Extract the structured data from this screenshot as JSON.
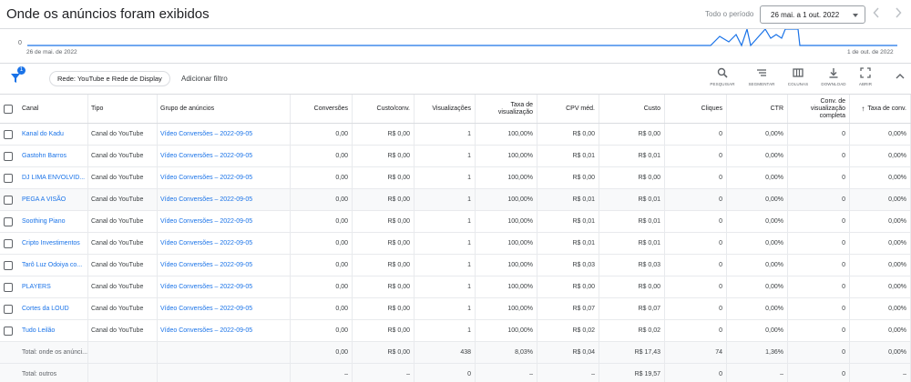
{
  "header": {
    "title": "Onde os anúncios foram exibidos",
    "period_label": "Todo o período",
    "date_range": "26 mai. a 1 out. 2022",
    "prev_icon": "chevron-left-icon",
    "next_icon": "chevron-right-icon"
  },
  "chart": {
    "y_zero": "0",
    "start_date": "26 de mai. de 2022",
    "end_date": "1 de out. de 2022",
    "line_color": "#1a73e8"
  },
  "filter_bar": {
    "badge": "1",
    "chip": "Rede: YouTube e Rede de Display",
    "add_filter": "Adicionar filtro",
    "tools": [
      {
        "icon": "search-icon",
        "label": "PESQUISAR"
      },
      {
        "icon": "segment-icon",
        "label": "SEGMENTAR"
      },
      {
        "icon": "columns-icon",
        "label": "COLUNAS"
      },
      {
        "icon": "download-icon",
        "label": "DOWNLOAD"
      },
      {
        "icon": "expand-icon",
        "label": "ABRIR"
      }
    ]
  },
  "table": {
    "columns": [
      "Canal",
      "Tipo",
      "Grupo de anúncios",
      "Conversões",
      "Custo/conv.",
      "Visualizações",
      "Taxa de visualização",
      "CPV méd.",
      "Custo",
      "Cliques",
      "CTR",
      "Conv. de visualização completa",
      "Taxa de conv."
    ],
    "rows": [
      [
        "Kanal do Kadu",
        "Canal do YouTube",
        "Vídeo Conversões – 2022-09-05",
        "0,00",
        "R$ 0,00",
        "1",
        "100,00%",
        "R$ 0,00",
        "R$ 0,00",
        "0",
        "0,00%",
        "0",
        "0,00%"
      ],
      [
        "Gastohn Barros",
        "Canal do YouTube",
        "Vídeo Conversões – 2022-09-05",
        "0,00",
        "R$ 0,00",
        "1",
        "100,00%",
        "R$ 0,01",
        "R$ 0,01",
        "0",
        "0,00%",
        "0",
        "0,00%"
      ],
      [
        "DJ LIMA ENVOLVID...",
        "Canal do YouTube",
        "Vídeo Conversões – 2022-09-05",
        "0,00",
        "R$ 0,00",
        "1",
        "100,00%",
        "R$ 0,00",
        "R$ 0,00",
        "0",
        "0,00%",
        "0",
        "0,00%"
      ],
      [
        "PEGA A VISÃO",
        "Canal do YouTube",
        "Vídeo Conversões – 2022-09-05",
        "0,00",
        "R$ 0,00",
        "1",
        "100,00%",
        "R$ 0,01",
        "R$ 0,01",
        "0",
        "0,00%",
        "0",
        "0,00%"
      ],
      [
        "Soothing Piano",
        "Canal do YouTube",
        "Vídeo Conversões – 2022-09-05",
        "0,00",
        "R$ 0,00",
        "1",
        "100,00%",
        "R$ 0,01",
        "R$ 0,01",
        "0",
        "0,00%",
        "0",
        "0,00%"
      ],
      [
        "Cripto Investimentos",
        "Canal do YouTube",
        "Vídeo Conversões – 2022-09-05",
        "0,00",
        "R$ 0,00",
        "1",
        "100,00%",
        "R$ 0,01",
        "R$ 0,01",
        "0",
        "0,00%",
        "0",
        "0,00%"
      ],
      [
        "Tarô Luz Odoiya co...",
        "Canal do YouTube",
        "Vídeo Conversões – 2022-09-05",
        "0,00",
        "R$ 0,00",
        "1",
        "100,00%",
        "R$ 0,03",
        "R$ 0,03",
        "0",
        "0,00%",
        "0",
        "0,00%"
      ],
      [
        "PLAYERS",
        "Canal do YouTube",
        "Vídeo Conversões – 2022-09-05",
        "0,00",
        "R$ 0,00",
        "1",
        "100,00%",
        "R$ 0,00",
        "R$ 0,00",
        "0",
        "0,00%",
        "0",
        "0,00%"
      ],
      [
        "Cortes da LOUD",
        "Canal do YouTube",
        "Vídeo Conversões – 2022-09-05",
        "0,00",
        "R$ 0,00",
        "1",
        "100,00%",
        "R$ 0,07",
        "R$ 0,07",
        "0",
        "0,00%",
        "0",
        "0,00%"
      ],
      [
        "Tudo Leilão",
        "Canal do YouTube",
        "Vídeo Conversões – 2022-09-05",
        "0,00",
        "R$ 0,00",
        "1",
        "100,00%",
        "R$ 0,02",
        "R$ 0,02",
        "0",
        "0,00%",
        "0",
        "0,00%"
      ]
    ],
    "totals": [
      [
        "Total: onde os anúnci...",
        "",
        "",
        "0,00",
        "R$ 0,00",
        "438",
        "8,03%",
        "R$ 0,04",
        "R$ 17,43",
        "74",
        "1,36%",
        "0",
        "0,00%"
      ],
      [
        "Total: outros",
        "",
        "",
        "–",
        "–",
        "0",
        "–",
        "–",
        "R$ 19,57",
        "0",
        "–",
        "0",
        "–"
      ]
    ]
  }
}
